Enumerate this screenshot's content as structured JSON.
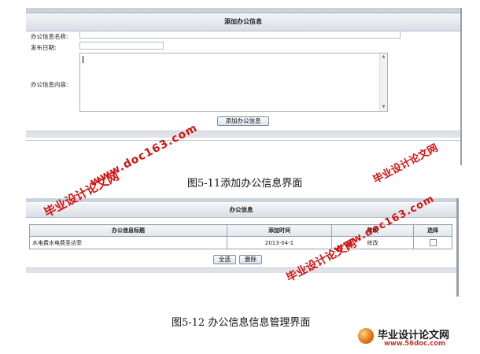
{
  "form_screen": {
    "title": "添加办公信息",
    "fields": [
      {
        "label": "办公信息名称:",
        "value": ""
      },
      {
        "label": "发布日期:",
        "value": ""
      },
      {
        "label": "办公信息内容:",
        "value": ""
      }
    ],
    "submit_label": "添加办公信息"
  },
  "caption1": "图5-11添加办公信息界面",
  "list_screen": {
    "title": "办公信息",
    "columns": [
      "办公信息标题",
      "添加时间",
      "修改",
      "选择"
    ],
    "rows": [
      {
        "title": "水电费水电费圣达菲",
        "time": "2013-04-1",
        "edit": "修改"
      }
    ],
    "select_all_label": "全选",
    "delete_label": "删除"
  },
  "caption2": "图5-12  办公信息信息管理界面",
  "watermarks": {
    "site_cn": "毕业设计论文网",
    "site_url": "www.doc163.com"
  },
  "logo": {
    "name": "毕业设计论文网",
    "url": "www.56doc.com"
  },
  "colors": {
    "watermark": "#d21414",
    "titlebar": "#dde2e9"
  }
}
